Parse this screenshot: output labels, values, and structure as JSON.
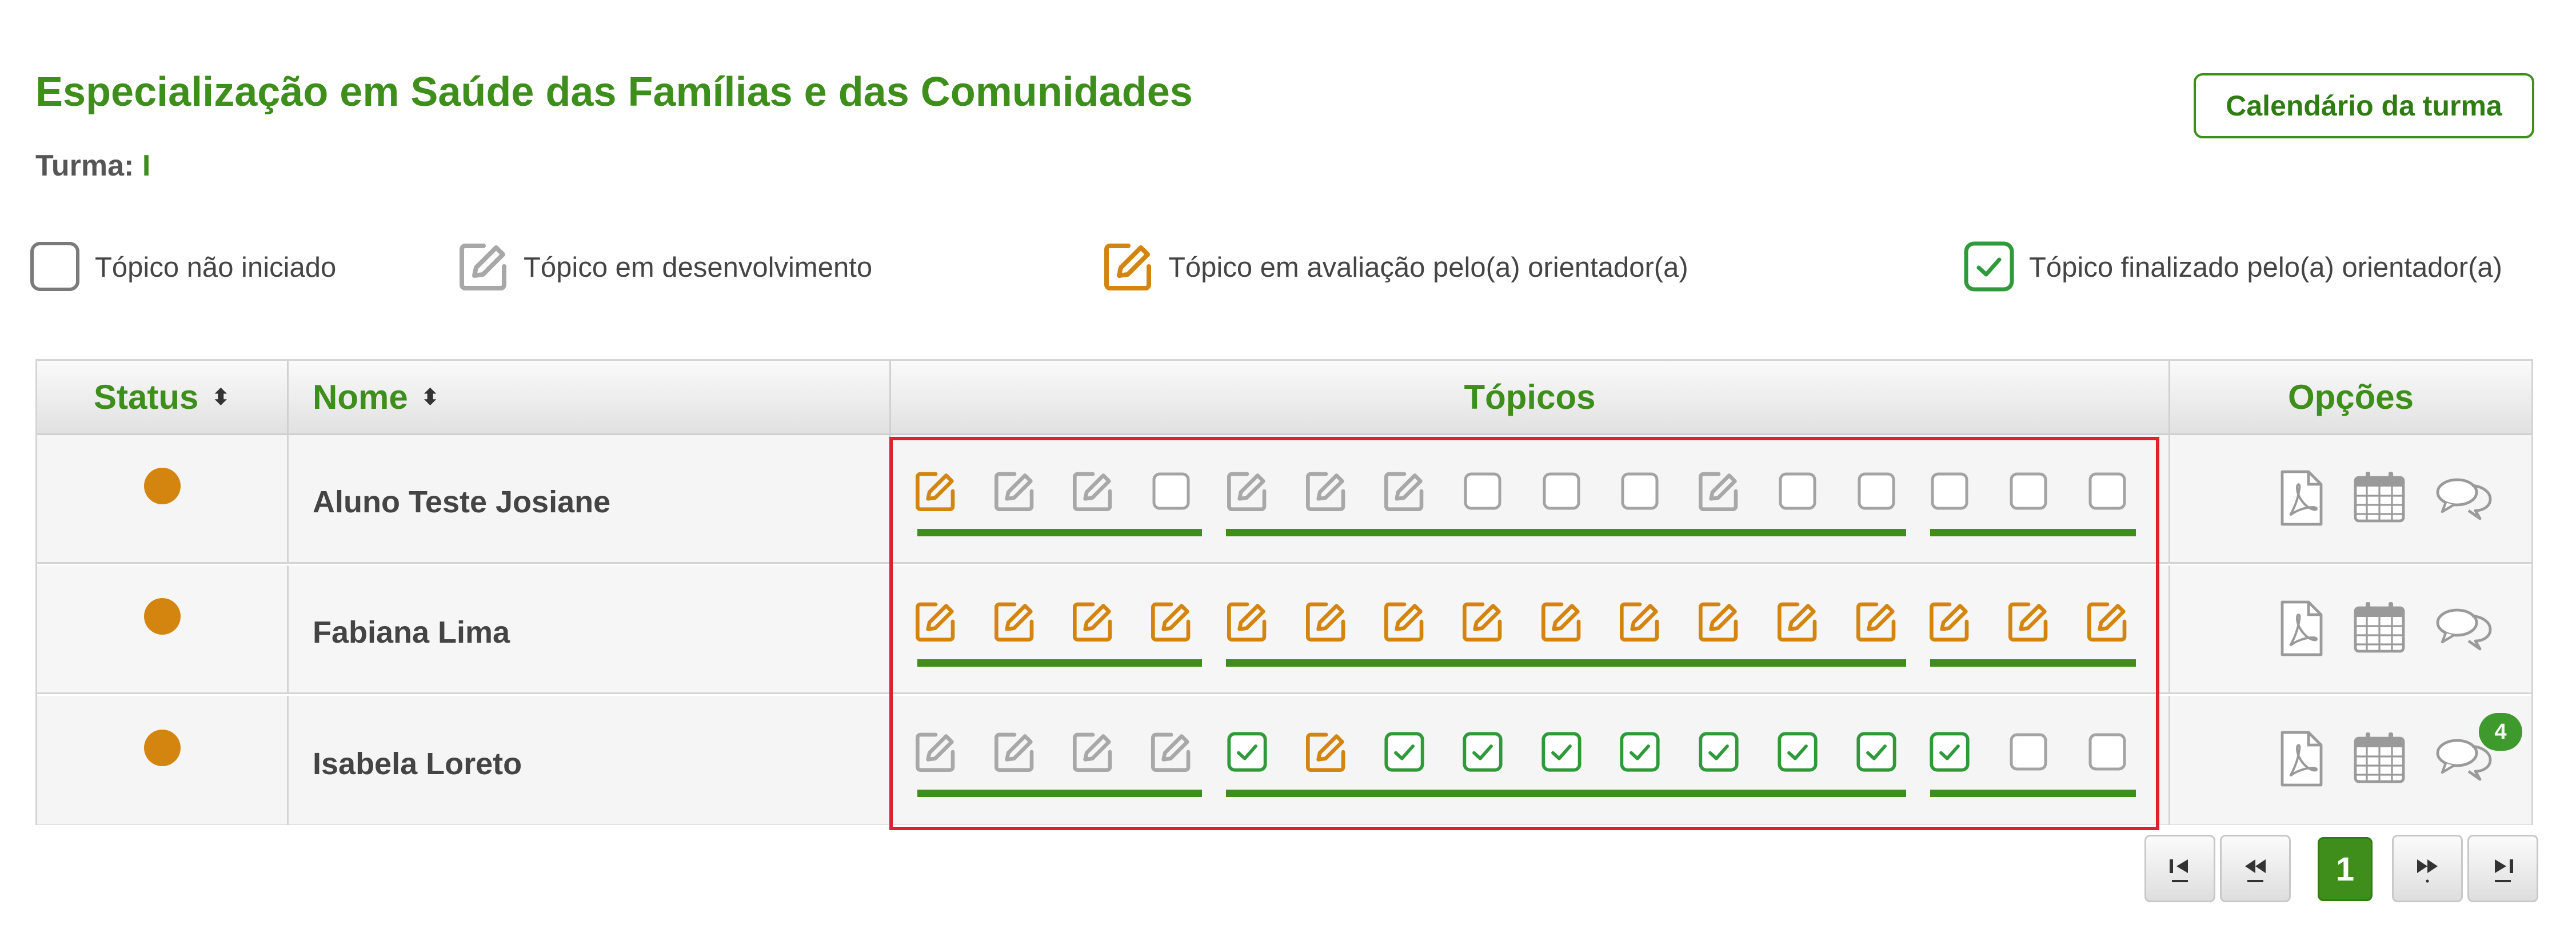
{
  "page": {
    "title": "Especialização em Saúde das Famílias e das Comunidades",
    "turma_label": "Turma:",
    "turma_value": "I",
    "calendar_button": "Calendário da turma"
  },
  "legend": [
    {
      "icon": "empty-checkbox-icon",
      "label": "Tópico não iniciado"
    },
    {
      "icon": "edit-gray-icon",
      "label": "Tópico em desenvolvimento"
    },
    {
      "icon": "edit-orange-icon",
      "label": "Tópico em avaliação pelo(a) orientador(a)"
    },
    {
      "icon": "check-green-icon",
      "label": "Tópico finalizado pelo(a) orientador(a)"
    }
  ],
  "table": {
    "headers": {
      "status": "Status",
      "name": "Nome",
      "topics": "Tópicos",
      "options": "Opções"
    },
    "sort_icon": "sort-icon",
    "rows": [
      {
        "name": "Aluno Teste Josiane",
        "status_color": "#d4850f",
        "topics": [
          "evaluating",
          "developing",
          "developing",
          "not_started",
          "developing",
          "developing",
          "developing",
          "not_started",
          "not_started",
          "not_started",
          "developing",
          "not_started",
          "not_started",
          "not_started",
          "not_started",
          "not_started"
        ],
        "message_count": null
      },
      {
        "name": "Fabiana Lima",
        "status_color": "#d4850f",
        "topics": [
          "evaluating",
          "evaluating",
          "evaluating",
          "evaluating",
          "evaluating",
          "evaluating",
          "evaluating",
          "evaluating",
          "evaluating",
          "evaluating",
          "evaluating",
          "evaluating",
          "evaluating",
          "evaluating",
          "evaluating",
          "evaluating"
        ],
        "message_count": null
      },
      {
        "name": "Isabela Loreto",
        "status_color": "#d4850f",
        "topics": [
          "developing",
          "developing",
          "developing",
          "developing",
          "finished",
          "evaluating",
          "finished",
          "finished",
          "finished",
          "finished",
          "finished",
          "finished",
          "finished",
          "finished",
          "not_started",
          "not_started"
        ],
        "message_count": "4"
      }
    ],
    "option_icons": [
      "pdf-icon",
      "calendar-icon",
      "chat-icon"
    ]
  },
  "pagination": {
    "first": "first-page-icon",
    "prev": "prev-page-icon",
    "current": "1",
    "next": "next-page-icon",
    "last": "last-page-icon"
  },
  "colors": {
    "brand_green": "#3e8e1c",
    "evaluating_orange": "#d4850f",
    "developing_gray": "#a8a8a8",
    "highlight_red": "#e0202a"
  }
}
